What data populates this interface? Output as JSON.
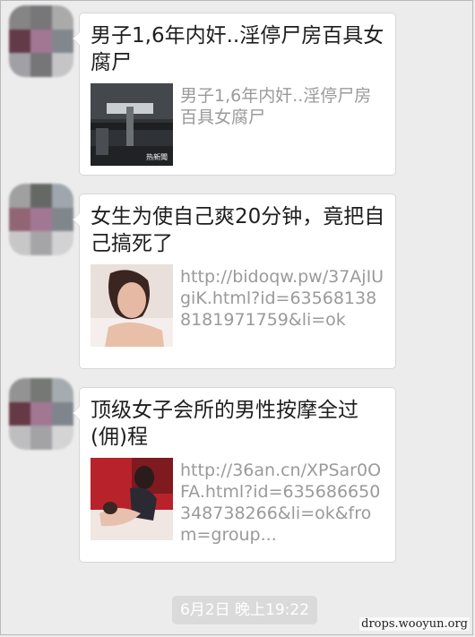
{
  "messages": [
    {
      "title": "男子1,6年内奸..淫停尸房百具女腐尸",
      "desc": "男子1,6年内奸..淫停尸房百具女腐尸",
      "thumb_badge": "热新聞"
    },
    {
      "title": "女生为使自己爽20分钟，竟把自己搞死了",
      "desc": "http://bidoqw.pw/37AjIUgiK.html?id=635681388181971759&li=ok"
    },
    {
      "title": "顶级女子会所的男性按摩全过(佣)程",
      "desc": "http://36an.cn/XPSar0OFA.html?id=635686650348738266&li=ok&from=group..."
    }
  ],
  "timestamp": "6月2日 晚上19:22",
  "watermark": "drops.wooyun.org",
  "colors": {
    "background": "#ececec",
    "bubble": "#ffffff",
    "title_text": "#1e1e1e",
    "desc_text": "#9a9a9a",
    "timestamp_bg": "#dadada"
  }
}
